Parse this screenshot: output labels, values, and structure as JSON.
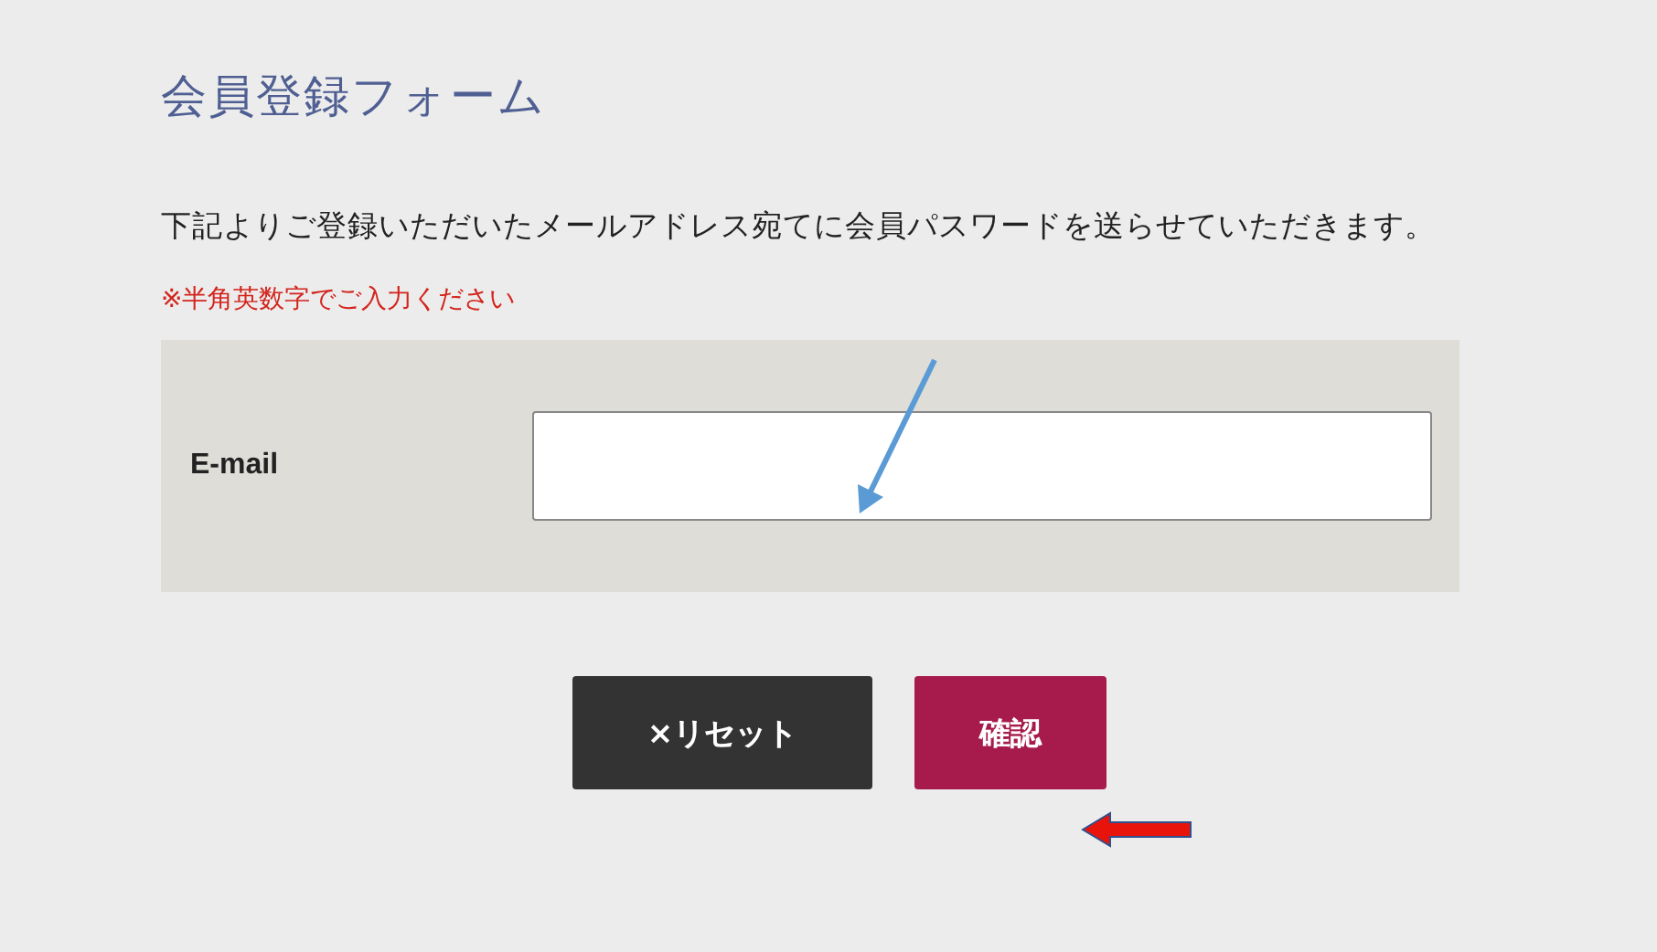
{
  "form": {
    "title": "会員登録フォーム",
    "description": "下記よりご登録いただいたメールアドレス宛てに会員パスワードを送らせていただきます。",
    "notice": "※半角英数字でご入力ください",
    "fields": [
      {
        "label": "E-mail",
        "kind": "text"
      }
    ]
  },
  "buttons": [
    {
      "label": "×リセット",
      "kind": "reset"
    },
    {
      "label": "確認",
      "kind": "submit"
    }
  ]
}
